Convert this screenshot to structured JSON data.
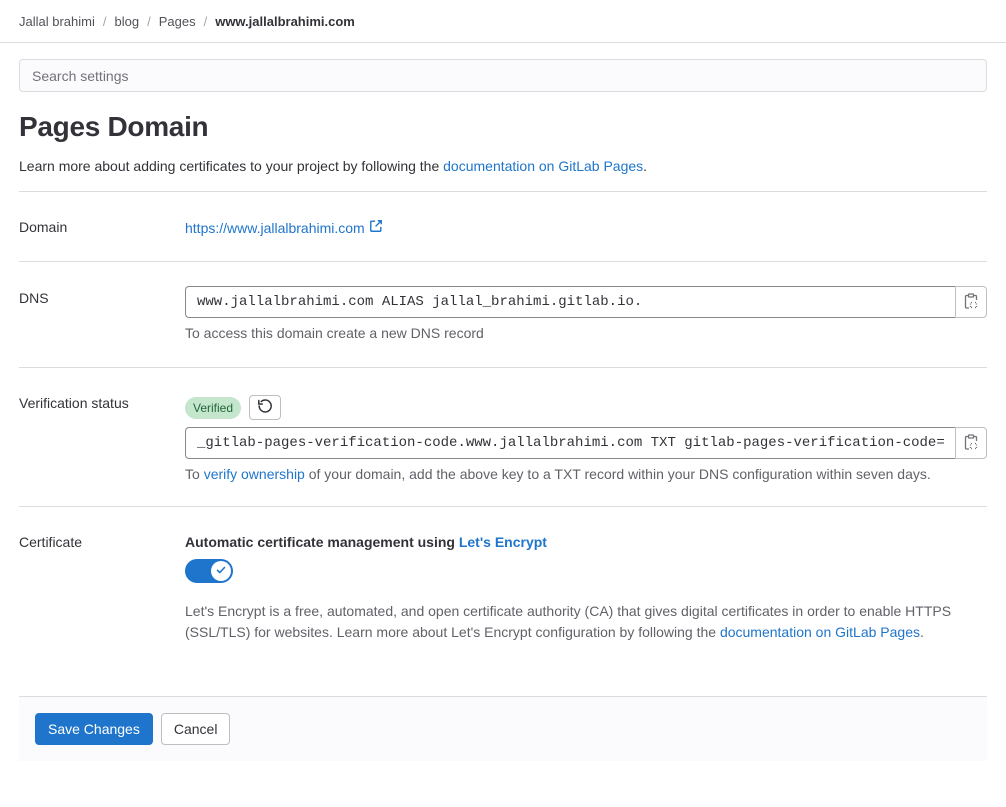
{
  "breadcrumb": {
    "items": [
      "Jallal brahimi",
      "blog",
      "Pages"
    ],
    "current": "www.jallalbrahimi.com",
    "separator": "/"
  },
  "search": {
    "placeholder": "Search settings",
    "value": ""
  },
  "page": {
    "title": "Pages Domain",
    "intro_text": "Learn more about adding certificates to your project by following the ",
    "intro_link": "documentation on GitLab Pages",
    "intro_suffix": "."
  },
  "domain": {
    "label": "Domain",
    "url": "https://www.jallalbrahimi.com",
    "icon": "external-link-icon"
  },
  "dns": {
    "label": "DNS",
    "record": "www.jallalbrahimi.com ALIAS jallal_brahimi.gitlab.io.",
    "help": "To access this domain create a new DNS record",
    "copy_icon": "copy-to-clipboard-icon"
  },
  "verification": {
    "label": "Verification status",
    "badge": "Verified",
    "retry_icon": "retry-icon",
    "record": "_gitlab-pages-verification-code.www.jallalbrahimi.com TXT gitlab-pages-verification-code=",
    "help_prefix": "To ",
    "help_link": "verify ownership",
    "help_suffix": " of your domain, add the above key to a TXT record within your DNS configuration within seven days.",
    "copy_icon": "copy-to-clipboard-icon"
  },
  "certificate": {
    "label": "Certificate",
    "title_prefix": "Automatic certificate management using ",
    "title_link": "Let's Encrypt",
    "toggle_on": true,
    "description": "Let's Encrypt is a free, automated, and open certificate authority (CA) that gives digital certificates in order to enable HTTPS (SSL/TLS) for websites. Learn more about Let's Encrypt configuration by following the ",
    "description_link": "documentation on GitLab Pages",
    "description_suffix": "."
  },
  "footer": {
    "save_label": "Save Changes",
    "cancel_label": "Cancel"
  },
  "colors": {
    "primary": "#1f75cb",
    "badge_bg": "#c3e6cd",
    "badge_text": "#24663b",
    "text": "#333238",
    "muted": "#626168"
  }
}
